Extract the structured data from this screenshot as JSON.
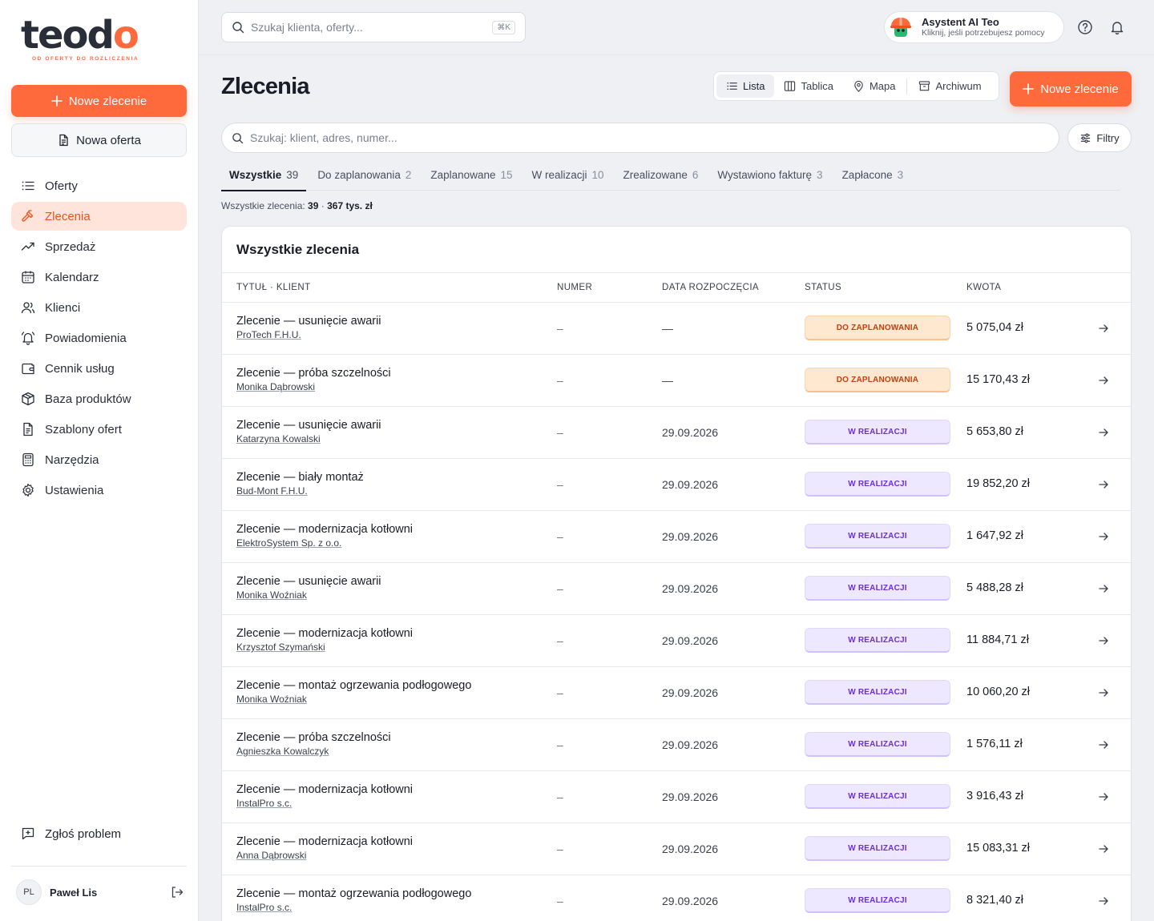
{
  "brand": {
    "logo_text": "teodo",
    "logo_tagline": "OD OFERTY DO ROZLICZENIA",
    "accent": "#ff6a3d"
  },
  "sidebar": {
    "new_order_label": "Nowe zlecenie",
    "new_offer_label": "Nowa oferta",
    "items": [
      {
        "label": "Oferty",
        "icon": "list-icon",
        "active": false
      },
      {
        "label": "Zlecenia",
        "icon": "hammer-icon",
        "active": true
      },
      {
        "label": "Sprzedaż",
        "icon": "trending-up-icon",
        "active": false
      },
      {
        "label": "Kalendarz",
        "icon": "calendar-icon",
        "active": false
      },
      {
        "label": "Klienci",
        "icon": "users-icon",
        "active": false
      },
      {
        "label": "Powiadomienia",
        "icon": "bell-ring-icon",
        "active": false
      },
      {
        "label": "Cennik usług",
        "icon": "wallet-icon",
        "active": false
      },
      {
        "label": "Baza produktów",
        "icon": "box-icon",
        "active": false
      },
      {
        "label": "Szablony ofert",
        "icon": "file-text-icon",
        "active": false
      },
      {
        "label": "Narzędzia",
        "icon": "calculator-icon",
        "active": false
      },
      {
        "label": "Ustawienia",
        "icon": "gear-icon",
        "active": false
      }
    ],
    "report_label": "Zgłoś problem",
    "user": {
      "initials": "PL",
      "name": "Paweł Lis"
    }
  },
  "topbar": {
    "search_placeholder": "Szukaj klienta, oferty...",
    "shortcut": "⌘K",
    "assistant_title": "Asystent AI Teo",
    "assistant_subtitle": "Kliknij, jeśli potrzebujesz pomocy"
  },
  "main": {
    "title": "Zlecenia",
    "view_tabs": [
      {
        "label": "Lista",
        "icon": "list-icon",
        "active": true
      },
      {
        "label": "Tablica",
        "icon": "columns-icon",
        "active": false
      },
      {
        "label": "Mapa",
        "icon": "map-pin-icon",
        "active": false
      },
      {
        "label": "Archiwum",
        "icon": "archive-icon",
        "active": false
      }
    ],
    "new_order_label": "Nowe zlecenie",
    "search_placeholder": "Szukaj: klient, adres, numer...",
    "filters_label": "Filtry",
    "status_tabs": [
      {
        "label": "Wszystkie",
        "count": "39",
        "active": true
      },
      {
        "label": "Do zaplanowania",
        "count": "2",
        "active": false
      },
      {
        "label": "Zaplanowane",
        "count": "15",
        "active": false
      },
      {
        "label": "W realizacji",
        "count": "10",
        "active": false
      },
      {
        "label": "Zrealizowane",
        "count": "6",
        "active": false
      },
      {
        "label": "Wystawiono fakturę",
        "count": "3",
        "active": false
      },
      {
        "label": "Zapłacone",
        "count": "3",
        "active": false
      }
    ],
    "summary_label": "Wszystkie zlecenia:",
    "summary_count": "39",
    "summary_sep": "·",
    "summary_amount": "367 tys. zł"
  },
  "table": {
    "title": "Wszystkie zlecenia",
    "columns": [
      "TYTUŁ · KLIENT",
      "NUMER",
      "DATA ROZPOCZĘCIA",
      "STATUS",
      "KWOTA"
    ],
    "rows": [
      {
        "title": "Zlecenie — usunięcie awarii",
        "client": "ProTech F.H.U.",
        "number": "–",
        "date": "—",
        "status": "DO ZAPLANOWANIA",
        "status_type": "plan",
        "amount": "5 075,04 zł"
      },
      {
        "title": "Zlecenie — próba szczelności",
        "client": "Monika Dąbrowski",
        "number": "–",
        "date": "—",
        "status": "DO ZAPLANOWANIA",
        "status_type": "plan",
        "amount": "15 170,43 zł"
      },
      {
        "title": "Zlecenie — usunięcie awarii",
        "client": "Katarzyna Kowalski",
        "number": "–",
        "date": "29.09.2026",
        "status": "W REALIZACJI",
        "status_type": "real",
        "amount": "5 653,80 zł"
      },
      {
        "title": "Zlecenie — biały montaż",
        "client": "Bud-Mont F.H.U.",
        "number": "–",
        "date": "29.09.2026",
        "status": "W REALIZACJI",
        "status_type": "real",
        "amount": "19 852,20 zł"
      },
      {
        "title": "Zlecenie — modernizacja kotłowni",
        "client": "ElektroSystem Sp. z o.o.",
        "number": "–",
        "date": "29.09.2026",
        "status": "W REALIZACJI",
        "status_type": "real",
        "amount": "1 647,92 zł"
      },
      {
        "title": "Zlecenie — usunięcie awarii",
        "client": "Monika Woźniak",
        "number": "–",
        "date": "29.09.2026",
        "status": "W REALIZACJI",
        "status_type": "real",
        "amount": "5 488,28 zł"
      },
      {
        "title": "Zlecenie — modernizacja kotłowni",
        "client": "Krzysztof Szymański",
        "number": "–",
        "date": "29.09.2026",
        "status": "W REALIZACJI",
        "status_type": "real",
        "amount": "11 884,71 zł"
      },
      {
        "title": "Zlecenie — montaż ogrzewania podłogowego",
        "client": "Monika Woźniak",
        "number": "–",
        "date": "29.09.2026",
        "status": "W REALIZACJI",
        "status_type": "real",
        "amount": "10 060,20 zł"
      },
      {
        "title": "Zlecenie — próba szczelności",
        "client": "Agnieszka Kowalczyk",
        "number": "–",
        "date": "29.09.2026",
        "status": "W REALIZACJI",
        "status_type": "real",
        "amount": "1 576,11 zł"
      },
      {
        "title": "Zlecenie — modernizacja kotłowni",
        "client": "InstalPro s.c.",
        "number": "–",
        "date": "29.09.2026",
        "status": "W REALIZACJI",
        "status_type": "real",
        "amount": "3 916,43 zł"
      },
      {
        "title": "Zlecenie — modernizacja kotłowni",
        "client": "Anna Dąbrowski",
        "number": "–",
        "date": "29.09.2026",
        "status": "W REALIZACJI",
        "status_type": "real",
        "amount": "15 083,31 zł"
      },
      {
        "title": "Zlecenie — montaż ogrzewania podłogowego",
        "client": "InstalPro s.c.",
        "number": "–",
        "date": "29.09.2026",
        "status": "W REALIZACJI",
        "status_type": "real",
        "amount": "8 321,40 zł"
      }
    ]
  }
}
